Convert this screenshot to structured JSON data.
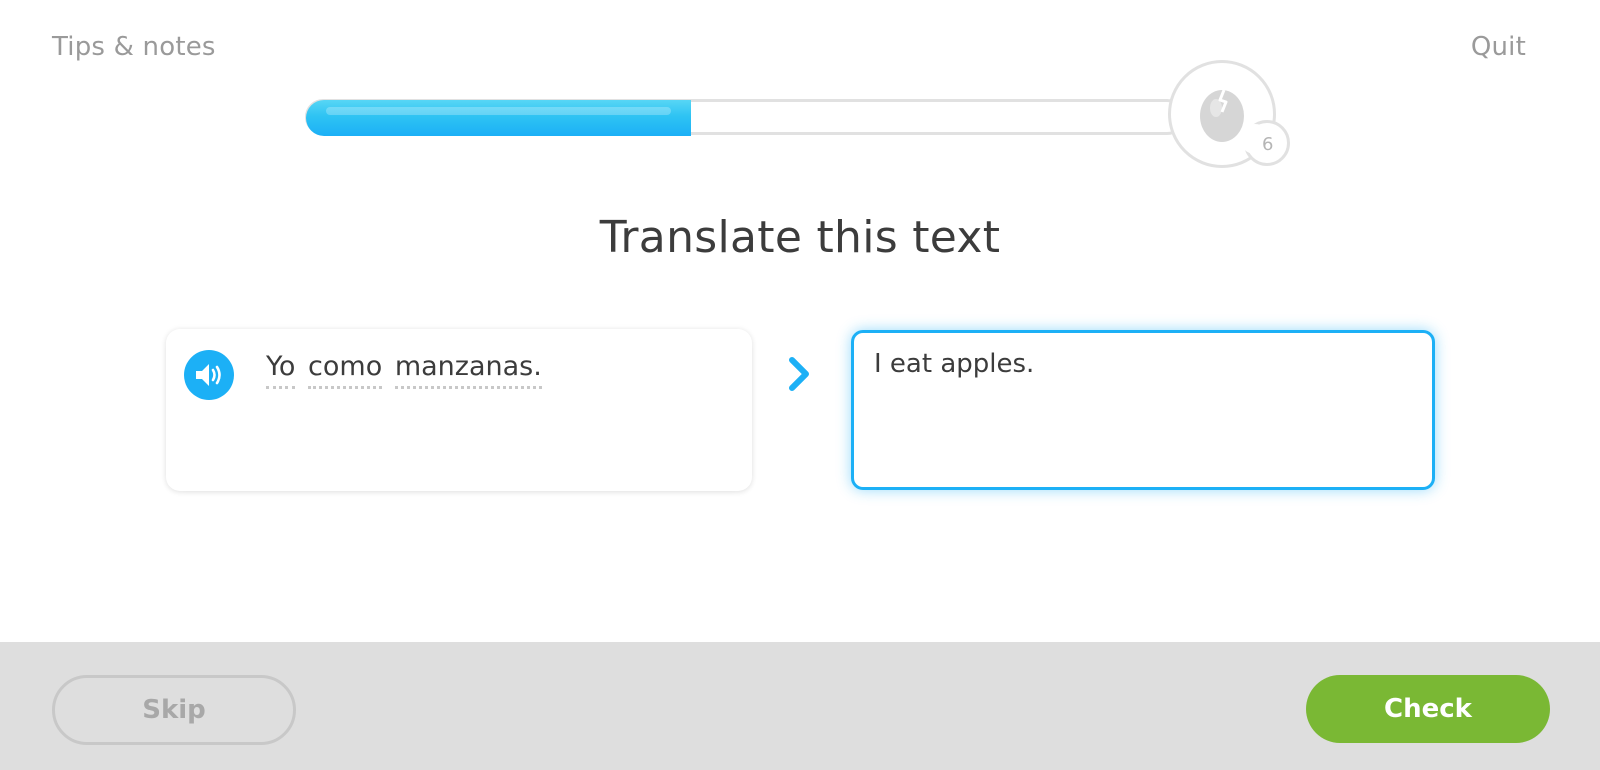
{
  "header": {
    "tips_label": "Tips & notes",
    "quit_label": "Quit"
  },
  "progress": {
    "fraction": 0.44,
    "egg_count": "6"
  },
  "prompt": {
    "title": "Translate this text"
  },
  "source": {
    "words": [
      "Yo",
      "como",
      "manzanas."
    ],
    "speaker_icon": "speaker-icon"
  },
  "answer": {
    "value": "I eat apples."
  },
  "footer": {
    "skip_label": "Skip",
    "check_label": "Check"
  },
  "colors": {
    "accent": "#1cb0f6",
    "check": "#7ab834",
    "footer_bg": "#dedede"
  }
}
